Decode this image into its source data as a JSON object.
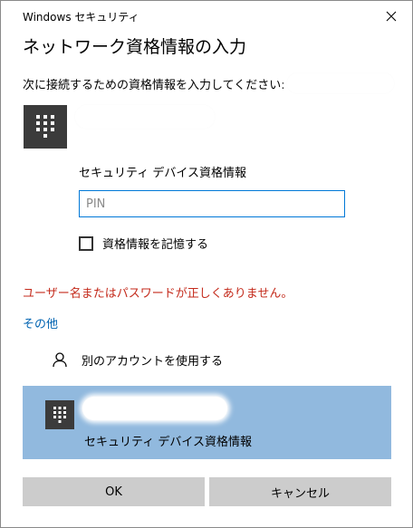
{
  "window": {
    "title": "Windows セキュリティ"
  },
  "dialog": {
    "heading": "ネットワーク資格情報の入力",
    "prompt": "次に接続するための資格情報を入力してください:",
    "field_label": "セキュリティ デバイス資格情報",
    "pin_placeholder": "PIN",
    "pin_value": "",
    "remember_label": "資格情報を記憶する",
    "remember_checked": false,
    "error": "ユーザー名またはパスワードが正しくありません。",
    "more_choices": "その他"
  },
  "options": {
    "other_account": "別のアカウントを使用する",
    "selected_label": "セキュリティ デバイス資格情報"
  },
  "buttons": {
    "ok": "OK",
    "cancel": "キャンセル"
  },
  "icons": {
    "close": "close-icon",
    "device": "keypad-icon",
    "other_account": "person-icon"
  },
  "colors": {
    "error": "#c42b1c",
    "link": "#0063b1",
    "selected_bg": "#91b9de",
    "input_border": "#0078d7",
    "button_bg": "#cccccc"
  }
}
